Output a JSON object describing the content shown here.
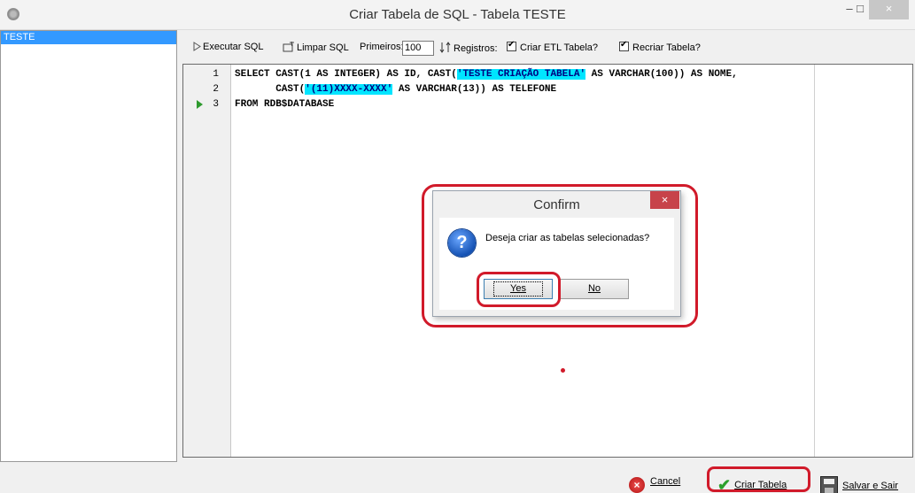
{
  "window": {
    "title": "Criar Tabela de SQL - Tabela TESTE",
    "min_glyph": "–",
    "max_glyph": "□",
    "close_glyph": "×"
  },
  "left_list": {
    "items": [
      "TESTE"
    ]
  },
  "toolbar": {
    "execute_label": "Executar SQL",
    "clear_label": "Limpar SQL",
    "first_label": "Primeiros:",
    "first_value": "100",
    "records_label": "Registros:",
    "create_etl_label": "Criar ETL Tabela?",
    "create_etl_checked": true,
    "recreate_label": "Recriar Tabela?",
    "recreate_checked": true
  },
  "editor": {
    "lines": [
      {
        "num": "1",
        "pre": "SELECT CAST(1 AS INTEGER) AS ID, CAST(",
        "hl": "'TESTE CRIAÇÃO TABELA'",
        "post": " AS VARCHAR(100)) AS NOME,"
      },
      {
        "num": "2",
        "pre": "       CAST(",
        "hl": "'(11)XXXX-XXXX'",
        "post": " AS VARCHAR(13)) AS TELEFONE"
      },
      {
        "num": "3",
        "pre": "FROM RDB$DATABASE",
        "hl": "",
        "post": ""
      }
    ],
    "current_line": "3"
  },
  "dialog": {
    "title": "Confirm",
    "message": "Deseja criar as tabelas selecionadas?",
    "yes_label": "Yes",
    "no_label": "No",
    "icon": "question-icon",
    "close_glyph": "×"
  },
  "bottom": {
    "cancel_label": "Cancel",
    "create_label": "Criar Tabela",
    "save_exit_label": "Salvar e Sair"
  },
  "colors": {
    "highlight": "#00e5ff",
    "annotation_red": "#d11a2a",
    "selection_blue": "#3399ff"
  }
}
